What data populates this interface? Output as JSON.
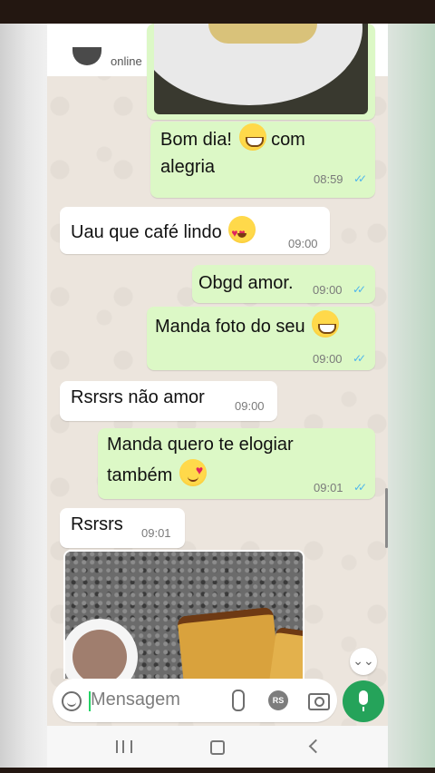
{
  "header": {
    "status": "online"
  },
  "messages": [
    {
      "direction": "out",
      "text_line1": "Bom dia!",
      "text_line1_after": "com",
      "text_line2": "alegria",
      "time": "08:59",
      "ticks": "✓✓",
      "emoji": "grinning-face-emoji"
    },
    {
      "direction": "in",
      "text": "Uau que café lindo",
      "time": "09:00",
      "emoji": "heart-eyes-emoji"
    },
    {
      "direction": "out",
      "text": "Obgd amor.",
      "time": "09:00",
      "ticks": "✓✓"
    },
    {
      "direction": "out",
      "text": "Manda foto do seu",
      "time": "09:00",
      "ticks": "✓✓",
      "emoji": "grinning-face-emoji"
    },
    {
      "direction": "in",
      "text": "Rsrsrs não amor",
      "time": "09:00"
    },
    {
      "direction": "out",
      "text_line1": "Manda quero te elogiar",
      "text_line2": "também",
      "time": "09:01",
      "ticks": "✓✓",
      "emoji": "smiling-face-with-hearts-emoji"
    },
    {
      "direction": "in",
      "text": "Rsrsrs",
      "time": "09:01"
    }
  ],
  "scroll_down_icon": "⌄⌄",
  "input": {
    "placeholder": "Mensagem",
    "rs_label": "RS"
  },
  "colors": {
    "outgoing_bubble": "#dcf8c6",
    "incoming_bubble": "#ffffff",
    "accent": "#25a35a",
    "read_ticks": "#4fb6ec"
  }
}
